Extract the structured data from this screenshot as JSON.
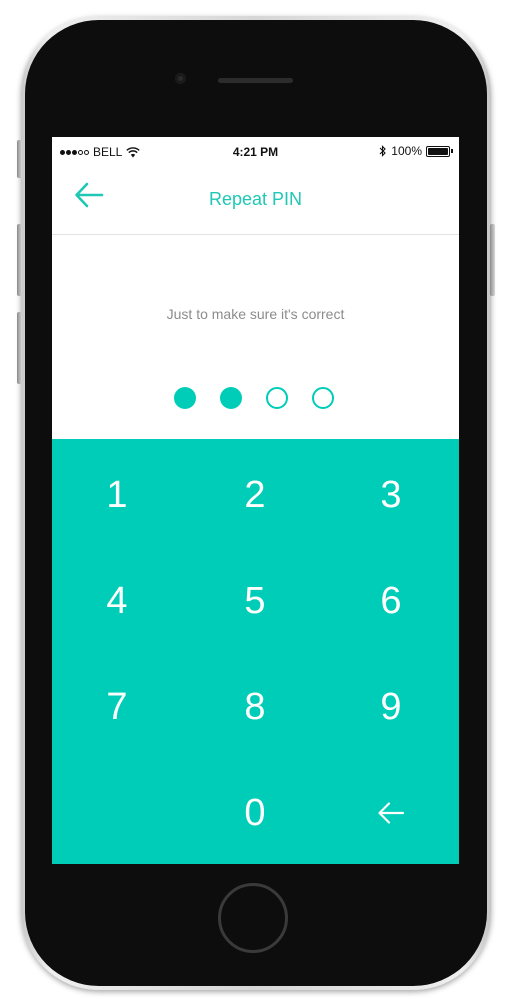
{
  "device": {
    "status_bar": {
      "carrier": "BELL",
      "signal_bars_filled": 3,
      "signal_bars_total": 5,
      "time": "4:21 PM",
      "battery_percent": "100%",
      "battery_level": 1.0
    }
  },
  "nav": {
    "title": "Repeat PIN",
    "back_icon": "arrow-left-icon"
  },
  "prompt": {
    "subtitle": "Just to make sure it's correct"
  },
  "pin": {
    "length": 4,
    "entered": 2
  },
  "keypad": {
    "keys": [
      "1",
      "2",
      "3",
      "4",
      "5",
      "6",
      "7",
      "8",
      "9",
      "",
      "0",
      "backspace-icon"
    ]
  },
  "colors": {
    "accent": "#00cdb8",
    "title": "#1ec8b4",
    "subtitle": "#8c8c8c",
    "screen_bg": "#ffffff",
    "phone_bezel": "#0d0d0d"
  }
}
